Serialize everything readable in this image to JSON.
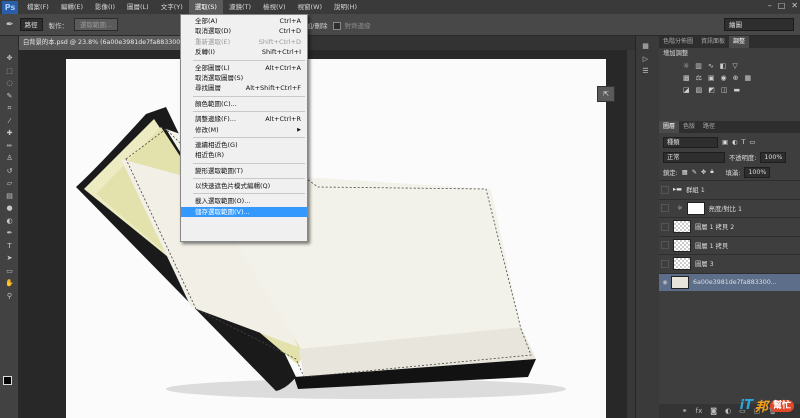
{
  "app": {
    "logo": "Ps"
  },
  "menubar": {
    "items": [
      "檔案(F)",
      "編輯(E)",
      "影像(I)",
      "圖層(L)",
      "文字(Y)",
      "選取(S)",
      "濾鏡(T)",
      "檢視(V)",
      "視窗(W)",
      "說明(H)"
    ],
    "active_index": 5
  },
  "optbar": {
    "tool_preset": "路徑",
    "make_label": "製作：",
    "make_selection": "選取範圍...",
    "mask_button": "遮色",
    "auto_add_delete": "自動增加/刪除",
    "align_edges": "對齊邊緣",
    "auto_add_checked": true,
    "workspace": "繪圖"
  },
  "document": {
    "tab_title": "白背景的本.psd @ 23.8% (6a00e3981de7fa883300..."
  },
  "select_menu": {
    "items": [
      {
        "label": "全部(A)",
        "shortcut": "Ctrl+A",
        "disabled": false
      },
      {
        "label": "取消選取(D)",
        "shortcut": "Ctrl+D",
        "disabled": false
      },
      {
        "label": "重新選取(E)",
        "shortcut": "Shift+Ctrl+D",
        "disabled": true
      },
      {
        "label": "反轉(I)",
        "shortcut": "Shift+Ctrl+I",
        "disabled": false
      },
      {
        "sep": true
      },
      {
        "label": "全部圖層(L)",
        "shortcut": "Alt+Ctrl+A",
        "disabled": false
      },
      {
        "label": "取消選取圖層(S)",
        "shortcut": "",
        "disabled": false
      },
      {
        "label": "尋找圖層",
        "shortcut": "Alt+Shift+Ctrl+F",
        "disabled": false
      },
      {
        "sep": true
      },
      {
        "label": "顏色範圍(C)...",
        "shortcut": "",
        "disabled": false
      },
      {
        "sep": true
      },
      {
        "label": "調整邊緣(F)...",
        "shortcut": "Alt+Ctrl+R",
        "disabled": false
      },
      {
        "label": "修改(M)",
        "shortcut": "",
        "disabled": false,
        "submenu": true
      },
      {
        "sep": true
      },
      {
        "label": "連續相近色(G)",
        "shortcut": "",
        "disabled": false
      },
      {
        "label": "相近色(R)",
        "shortcut": "",
        "disabled": false
      },
      {
        "sep": true
      },
      {
        "label": "變形選取範圍(T)",
        "shortcut": "",
        "disabled": false
      },
      {
        "sep": true
      },
      {
        "label": "以快速遮色片模式編輯(Q)",
        "shortcut": "",
        "disabled": false
      },
      {
        "sep": true
      },
      {
        "label": "載入選取範圍(O)...",
        "shortcut": "",
        "disabled": false
      },
      {
        "label": "儲存選取範圍(V)...",
        "shortcut": "",
        "disabled": false,
        "highlight": true
      }
    ]
  },
  "panels": {
    "top_tabs": [
      "色階分佈圖",
      "資訊面板",
      "調整"
    ],
    "top_active": 2,
    "adjust_title": "增加調整",
    "layers_tabs": [
      "圖層",
      "色版",
      "路徑"
    ],
    "kind_label": "種類",
    "blend_mode": "正常",
    "opacity_label": "不透明度:",
    "opacity_value": "100%",
    "lock_label": "鎖定:",
    "fill_label": "填滿:",
    "fill_value": "100%",
    "layers": [
      {
        "name": "群組 1",
        "type": "group"
      },
      {
        "name": "亮度/對比 1",
        "type": "adjustment"
      },
      {
        "name": "圖層 1 拷貝 2",
        "type": "pixel"
      },
      {
        "name": "圖層 1 拷貝",
        "type": "pixel"
      },
      {
        "name": "圖層 3",
        "type": "pixel"
      },
      {
        "name": "6a00e3981de7fa883300...",
        "type": "photo",
        "selected": true
      }
    ]
  },
  "watermark": {
    "text1": "iT",
    "text2": "邦",
    "text3": "幫忙"
  }
}
